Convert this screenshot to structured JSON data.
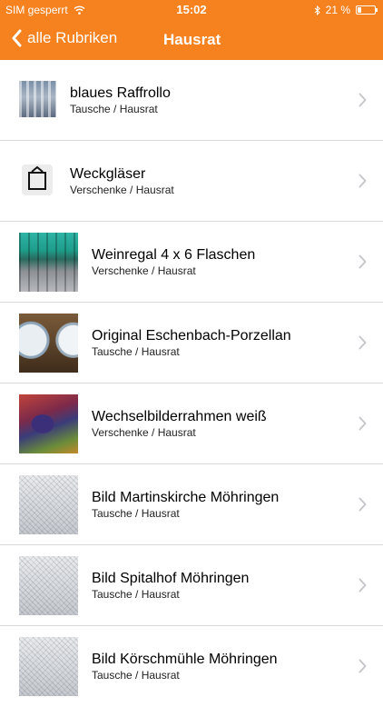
{
  "status_bar": {
    "carrier": "SIM gesperrt",
    "time": "15:02",
    "battery_text": "21 %",
    "battery_level": 0.21,
    "icons": [
      "wifi-icon",
      "bluetooth-icon",
      "battery-icon"
    ]
  },
  "nav_bar": {
    "back_label": "alle Rubriken",
    "title": "Hausrat",
    "background_color": "#f5811f",
    "icon": "chevron-left-icon"
  },
  "items": [
    {
      "title": "blaues Raffrollo",
      "subtitle": "Tausche / Hausrat"
    },
    {
      "title": "Weckgläser",
      "subtitle": "Verschenke / Hausrat"
    },
    {
      "title": "Weinregal 4 x 6 Flaschen",
      "subtitle": "Verschenke / Hausrat"
    },
    {
      "title": "Original Eschenbach-Porzellan",
      "subtitle": "Tausche / Hausrat"
    },
    {
      "title": "Wechselbilderrahmen weiß",
      "subtitle": "Verschenke / Hausrat"
    },
    {
      "title": "Bild Martinskirche Möhringen",
      "subtitle": "Tausche / Hausrat"
    },
    {
      "title": "Bild Spitalhof Möhringen",
      "subtitle": "Tausche / Hausrat"
    },
    {
      "title": "Bild Körschmühle Möhringen",
      "subtitle": "Tausche / Hausrat"
    }
  ]
}
